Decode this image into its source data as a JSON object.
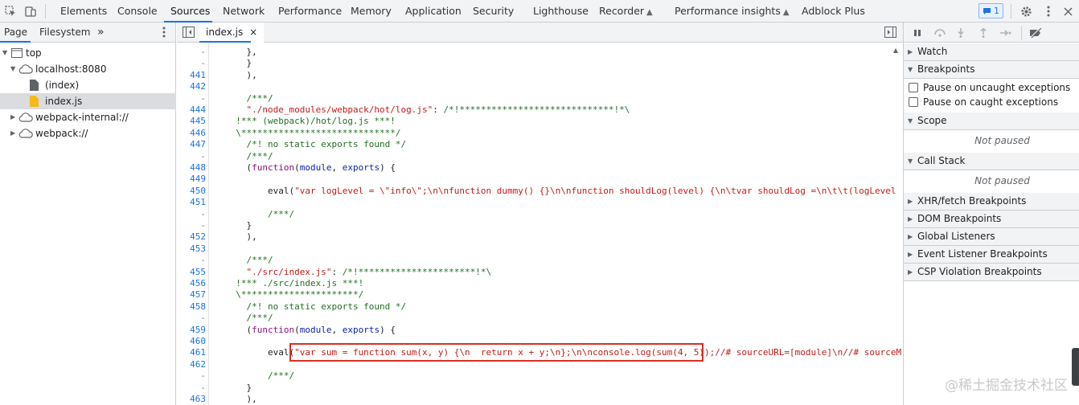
{
  "topbar": {
    "tabs": [
      {
        "id": "elements",
        "label": "Elements"
      },
      {
        "id": "console",
        "label": "Console"
      },
      {
        "id": "sources",
        "label": "Sources"
      },
      {
        "id": "network",
        "label": "Network"
      },
      {
        "id": "performance",
        "label": "Performance"
      },
      {
        "id": "memory",
        "label": "Memory"
      },
      {
        "id": "application",
        "label": "Application"
      },
      {
        "id": "security",
        "label": "Security"
      },
      {
        "id": "lighthouse",
        "label": "Lighthouse"
      },
      {
        "id": "recorder",
        "label": "Recorder"
      },
      {
        "id": "performance-insights",
        "label": "Performance insights"
      },
      {
        "id": "adblock-plus",
        "label": "Adblock Plus"
      }
    ],
    "active_tab": "Sources",
    "message_count": "1"
  },
  "navigator": {
    "tabs": {
      "page": "Page",
      "filesystem": "Filesystem",
      "more": "»"
    },
    "tree": [
      {
        "label": "top"
      },
      {
        "label": "localhost:8080"
      },
      {
        "label": "(index)"
      },
      {
        "label": "index.js"
      },
      {
        "label": "webpack-internal://"
      },
      {
        "label": "webpack://"
      }
    ]
  },
  "editor": {
    "open_file": "index.js",
    "close_glyph": "×",
    "gutter": [
      "-",
      "-",
      "441",
      "442",
      "-",
      "444",
      "445",
      "446",
      "447",
      "-",
      "448",
      "449",
      "450",
      "451",
      "-",
      "-",
      "452",
      "453",
      "-",
      "455",
      "456",
      "457",
      "458",
      "-",
      "459",
      "460",
      "461",
      "462",
      "-",
      "-",
      "463"
    ],
    "lines": [
      {
        "segments": [
          {
            "t": "    },",
            "c": ""
          }
        ]
      },
      {
        "segments": [
          {
            "t": "    }",
            "c": ""
          }
        ]
      },
      {
        "segments": [
          {
            "t": "    ),",
            "c": ""
          }
        ]
      },
      {
        "segments": [
          {
            "t": "",
            "c": ""
          }
        ]
      },
      {
        "segments": [
          {
            "t": "    /***/",
            "c": "c-cmt"
          }
        ]
      },
      {
        "segments": [
          {
            "t": "    \"./node_modules/webpack/hot/log.js\"",
            "c": "c-str"
          },
          {
            "t": ": ",
            "c": ""
          },
          {
            "t": "/*!*****************************!*\\",
            "c": "c-cmt"
          }
        ]
      },
      {
        "segments": [
          {
            "t": "  !*** (webpack)/hot/log.js ***!",
            "c": "c-cmt"
          }
        ]
      },
      {
        "segments": [
          {
            "t": "  \\*****************************/",
            "c": "c-cmt"
          }
        ]
      },
      {
        "segments": [
          {
            "t": "    /*! no static exports found */",
            "c": "c-cmt"
          }
        ]
      },
      {
        "segments": [
          {
            "t": "    /***/",
            "c": "c-cmt"
          }
        ]
      },
      {
        "segments": [
          {
            "t": "    (",
            "c": ""
          },
          {
            "t": "function",
            "c": "c-kw"
          },
          {
            "t": "(",
            "c": ""
          },
          {
            "t": "module",
            "c": "c-var"
          },
          {
            "t": ", ",
            "c": ""
          },
          {
            "t": "exports",
            "c": "c-var"
          },
          {
            "t": ") {",
            "c": ""
          }
        ]
      },
      {
        "segments": [
          {
            "t": "",
            "c": ""
          }
        ]
      },
      {
        "segments": [
          {
            "t": "        eval(",
            "c": ""
          },
          {
            "t": "\"var logLevel = \\\"info\\\";\\n\\nfunction dummy() {}\\n\\nfunction shouldLog(level) {\\n\\tvar shouldLog =\\n\\t\\t(logLevel",
            "c": "c-str"
          }
        ]
      },
      {
        "segments": [
          {
            "t": "",
            "c": ""
          }
        ]
      },
      {
        "segments": [
          {
            "t": "        /***/",
            "c": "c-cmt"
          }
        ]
      },
      {
        "segments": [
          {
            "t": "    }",
            "c": ""
          }
        ]
      },
      {
        "segments": [
          {
            "t": "    ),",
            "c": ""
          }
        ]
      },
      {
        "segments": [
          {
            "t": "",
            "c": ""
          }
        ]
      },
      {
        "segments": [
          {
            "t": "    /***/",
            "c": "c-cmt"
          }
        ]
      },
      {
        "segments": [
          {
            "t": "    \"./src/index.js\"",
            "c": "c-str"
          },
          {
            "t": ": ",
            "c": ""
          },
          {
            "t": "/*!**********************!*\\",
            "c": "c-cmt"
          }
        ]
      },
      {
        "segments": [
          {
            "t": "  !*** ./src/index.js ***!",
            "c": "c-cmt"
          }
        ]
      },
      {
        "segments": [
          {
            "t": "  \\**********************/",
            "c": "c-cmt"
          }
        ]
      },
      {
        "segments": [
          {
            "t": "    /*! no static exports found */",
            "c": "c-cmt"
          }
        ]
      },
      {
        "segments": [
          {
            "t": "    /***/",
            "c": "c-cmt"
          }
        ]
      },
      {
        "segments": [
          {
            "t": "    (",
            "c": ""
          },
          {
            "t": "function",
            "c": "c-kw"
          },
          {
            "t": "(",
            "c": ""
          },
          {
            "t": "module",
            "c": "c-var"
          },
          {
            "t": ", ",
            "c": ""
          },
          {
            "t": "exports",
            "c": "c-var"
          },
          {
            "t": ") {",
            "c": ""
          }
        ]
      },
      {
        "segments": [
          {
            "t": "",
            "c": ""
          }
        ]
      },
      {
        "segments": [
          {
            "t": "        eval(",
            "c": ""
          },
          {
            "t": "\"var sum = function sum(x, y) {\\n  return x + y;\\n};\\n\\nconsole.log(sum(4, 5));//# sourceURL=[module]\\n//# sourceM",
            "c": "c-str"
          }
        ]
      },
      {
        "segments": [
          {
            "t": "",
            "c": ""
          }
        ]
      },
      {
        "segments": [
          {
            "t": "        /***/",
            "c": "c-cmt"
          }
        ]
      },
      {
        "segments": [
          {
            "t": "    }",
            "c": ""
          }
        ]
      },
      {
        "segments": [
          {
            "t": "    ),",
            "c": ""
          }
        ]
      },
      {
        "segments": [
          {
            "t": "",
            "c": ""
          }
        ]
      }
    ]
  },
  "debugger": {
    "sections": {
      "watch": "Watch",
      "breakpoints": "Breakpoints",
      "pause_uncaught": "Pause on uncaught exceptions",
      "pause_caught": "Pause on caught exceptions",
      "scope": "Scope",
      "scope_status": "Not paused",
      "call_stack": "Call Stack",
      "call_stack_status": "Not paused",
      "xhr": "XHR/fetch Breakpoints",
      "dom": "DOM Breakpoints",
      "global": "Global Listeners",
      "event": "Event Listener Breakpoints",
      "csp": "CSP Violation Breakpoints"
    }
  },
  "watermark": "@稀土掘金技术社区"
}
